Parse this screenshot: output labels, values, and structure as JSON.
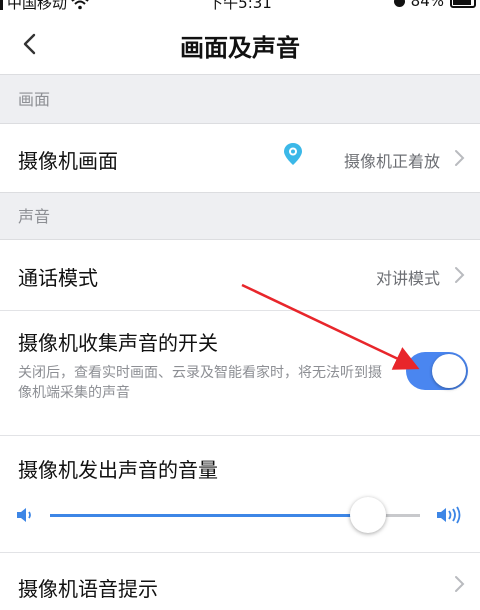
{
  "status_bar": {
    "carrier": "中国移动",
    "time": "下午5:31",
    "battery": "84%"
  },
  "nav": {
    "title": "画面及声音"
  },
  "sections": {
    "picture": "画面",
    "sound": "声音"
  },
  "camera_picture": {
    "label": "摄像机画面",
    "value": "摄像机正着放"
  },
  "call_mode": {
    "label": "通话模式",
    "value": "对讲模式"
  },
  "sound_collection": {
    "label": "摄像机收集声音的开关",
    "description": "关闭后，查看实时画面、云录及智能看家时，将无法听到摄像机端采集的声音",
    "enabled": true
  },
  "output_volume": {
    "label": "摄像机发出声音的音量",
    "level_percent": 86
  },
  "voice_prompt": {
    "label": "摄像机语音提示"
  },
  "colors": {
    "accent": "#4a86f0",
    "annotation_arrow": "#e8262b",
    "pin": "#3bb8e8"
  },
  "icons": {
    "back": "chevron-left-icon",
    "camera_pin": "location-pin-icon",
    "volume_low": "volume-low-icon",
    "volume_high": "volume-high-icon"
  }
}
